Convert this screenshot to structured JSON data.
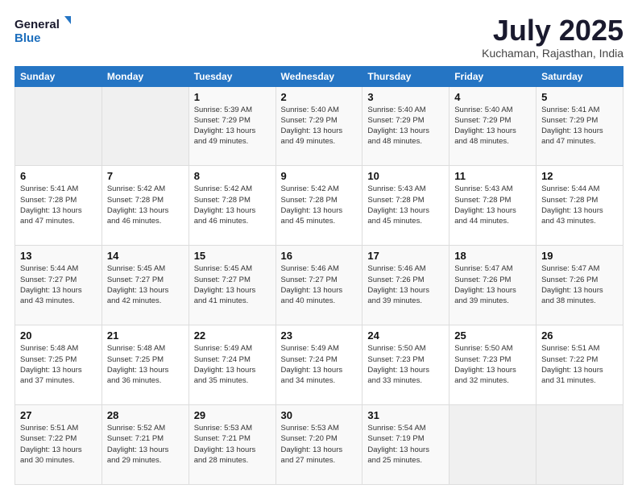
{
  "logo": {
    "line1": "General",
    "line2": "Blue"
  },
  "header": {
    "month": "July 2025",
    "location": "Kuchaman, Rajasthan, India"
  },
  "weekdays": [
    "Sunday",
    "Monday",
    "Tuesday",
    "Wednesday",
    "Thursday",
    "Friday",
    "Saturday"
  ],
  "weeks": [
    [
      {
        "day": "",
        "info": ""
      },
      {
        "day": "",
        "info": ""
      },
      {
        "day": "1",
        "info": "Sunrise: 5:39 AM\nSunset: 7:29 PM\nDaylight: 13 hours and 49 minutes."
      },
      {
        "day": "2",
        "info": "Sunrise: 5:40 AM\nSunset: 7:29 PM\nDaylight: 13 hours and 49 minutes."
      },
      {
        "day": "3",
        "info": "Sunrise: 5:40 AM\nSunset: 7:29 PM\nDaylight: 13 hours and 48 minutes."
      },
      {
        "day": "4",
        "info": "Sunrise: 5:40 AM\nSunset: 7:29 PM\nDaylight: 13 hours and 48 minutes."
      },
      {
        "day": "5",
        "info": "Sunrise: 5:41 AM\nSunset: 7:29 PM\nDaylight: 13 hours and 47 minutes."
      }
    ],
    [
      {
        "day": "6",
        "info": "Sunrise: 5:41 AM\nSunset: 7:28 PM\nDaylight: 13 hours and 47 minutes."
      },
      {
        "day": "7",
        "info": "Sunrise: 5:42 AM\nSunset: 7:28 PM\nDaylight: 13 hours and 46 minutes."
      },
      {
        "day": "8",
        "info": "Sunrise: 5:42 AM\nSunset: 7:28 PM\nDaylight: 13 hours and 46 minutes."
      },
      {
        "day": "9",
        "info": "Sunrise: 5:42 AM\nSunset: 7:28 PM\nDaylight: 13 hours and 45 minutes."
      },
      {
        "day": "10",
        "info": "Sunrise: 5:43 AM\nSunset: 7:28 PM\nDaylight: 13 hours and 45 minutes."
      },
      {
        "day": "11",
        "info": "Sunrise: 5:43 AM\nSunset: 7:28 PM\nDaylight: 13 hours and 44 minutes."
      },
      {
        "day": "12",
        "info": "Sunrise: 5:44 AM\nSunset: 7:28 PM\nDaylight: 13 hours and 43 minutes."
      }
    ],
    [
      {
        "day": "13",
        "info": "Sunrise: 5:44 AM\nSunset: 7:27 PM\nDaylight: 13 hours and 43 minutes."
      },
      {
        "day": "14",
        "info": "Sunrise: 5:45 AM\nSunset: 7:27 PM\nDaylight: 13 hours and 42 minutes."
      },
      {
        "day": "15",
        "info": "Sunrise: 5:45 AM\nSunset: 7:27 PM\nDaylight: 13 hours and 41 minutes."
      },
      {
        "day": "16",
        "info": "Sunrise: 5:46 AM\nSunset: 7:27 PM\nDaylight: 13 hours and 40 minutes."
      },
      {
        "day": "17",
        "info": "Sunrise: 5:46 AM\nSunset: 7:26 PM\nDaylight: 13 hours and 39 minutes."
      },
      {
        "day": "18",
        "info": "Sunrise: 5:47 AM\nSunset: 7:26 PM\nDaylight: 13 hours and 39 minutes."
      },
      {
        "day": "19",
        "info": "Sunrise: 5:47 AM\nSunset: 7:26 PM\nDaylight: 13 hours and 38 minutes."
      }
    ],
    [
      {
        "day": "20",
        "info": "Sunrise: 5:48 AM\nSunset: 7:25 PM\nDaylight: 13 hours and 37 minutes."
      },
      {
        "day": "21",
        "info": "Sunrise: 5:48 AM\nSunset: 7:25 PM\nDaylight: 13 hours and 36 minutes."
      },
      {
        "day": "22",
        "info": "Sunrise: 5:49 AM\nSunset: 7:24 PM\nDaylight: 13 hours and 35 minutes."
      },
      {
        "day": "23",
        "info": "Sunrise: 5:49 AM\nSunset: 7:24 PM\nDaylight: 13 hours and 34 minutes."
      },
      {
        "day": "24",
        "info": "Sunrise: 5:50 AM\nSunset: 7:23 PM\nDaylight: 13 hours and 33 minutes."
      },
      {
        "day": "25",
        "info": "Sunrise: 5:50 AM\nSunset: 7:23 PM\nDaylight: 13 hours and 32 minutes."
      },
      {
        "day": "26",
        "info": "Sunrise: 5:51 AM\nSunset: 7:22 PM\nDaylight: 13 hours and 31 minutes."
      }
    ],
    [
      {
        "day": "27",
        "info": "Sunrise: 5:51 AM\nSunset: 7:22 PM\nDaylight: 13 hours and 30 minutes."
      },
      {
        "day": "28",
        "info": "Sunrise: 5:52 AM\nSunset: 7:21 PM\nDaylight: 13 hours and 29 minutes."
      },
      {
        "day": "29",
        "info": "Sunrise: 5:53 AM\nSunset: 7:21 PM\nDaylight: 13 hours and 28 minutes."
      },
      {
        "day": "30",
        "info": "Sunrise: 5:53 AM\nSunset: 7:20 PM\nDaylight: 13 hours and 27 minutes."
      },
      {
        "day": "31",
        "info": "Sunrise: 5:54 AM\nSunset: 7:19 PM\nDaylight: 13 hours and 25 minutes."
      },
      {
        "day": "",
        "info": ""
      },
      {
        "day": "",
        "info": ""
      }
    ]
  ]
}
